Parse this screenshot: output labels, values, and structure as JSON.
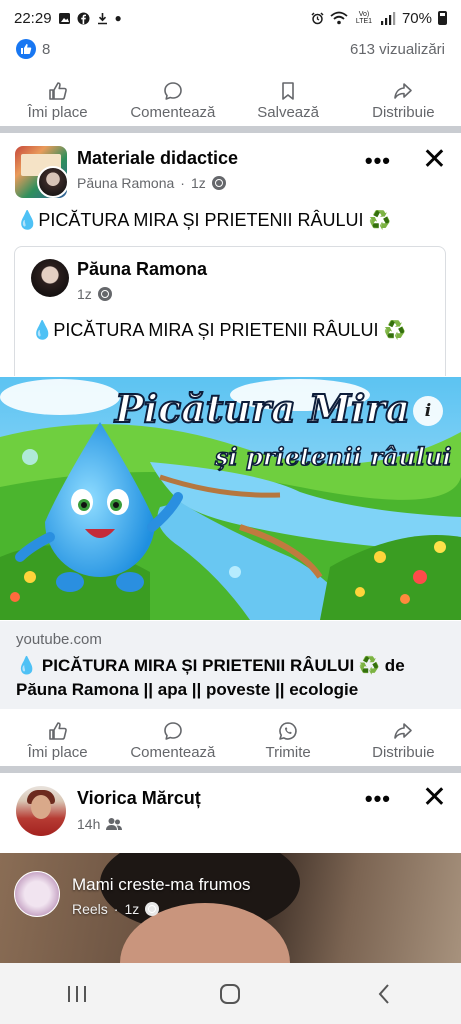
{
  "status_bar": {
    "time": "22:29",
    "battery": "70%",
    "network_label": "Vo) LTE1"
  },
  "post1": {
    "reaction_count": "8",
    "views": "613 vizualizări"
  },
  "actions1": {
    "like": "Îmi place",
    "comment": "Comentează",
    "save": "Salvează",
    "share": "Distribuie"
  },
  "post2": {
    "group_name": "Materiale didactice",
    "author": "Păuna Ramona",
    "time": "1z",
    "separator": "·",
    "text": "💧PICĂTURA MIRA ȘI PRIETENII RÂULUI ♻️",
    "shared": {
      "author": "Păuna Ramona",
      "time": "1z",
      "text": "💧PICĂTURA MIRA ȘI PRIETENII RÂULUI ♻️"
    },
    "thumbnail": {
      "title_line1": "Picătura Mira",
      "title_line2": "și prietenii râului"
    },
    "link": {
      "domain": "youtube.com",
      "title": "💧 PICĂTURA MIRA ȘI PRIETENII RÂULUI ♻️ de Păuna Ramona || apa || poveste || ecologie"
    }
  },
  "actions2": {
    "like": "Îmi place",
    "comment": "Comentează",
    "send": "Trimite",
    "share": "Distribuie"
  },
  "post3": {
    "author": "Viorica Mărcuț",
    "time": "14h",
    "reel": {
      "page_name": "Mami creste-ma frumos",
      "sub_label": "Reels",
      "time": "1z"
    }
  },
  "colors": {
    "facebook_blue": "#1877f2",
    "secondary_text": "#65676b",
    "divider": "#c9ccd1"
  }
}
